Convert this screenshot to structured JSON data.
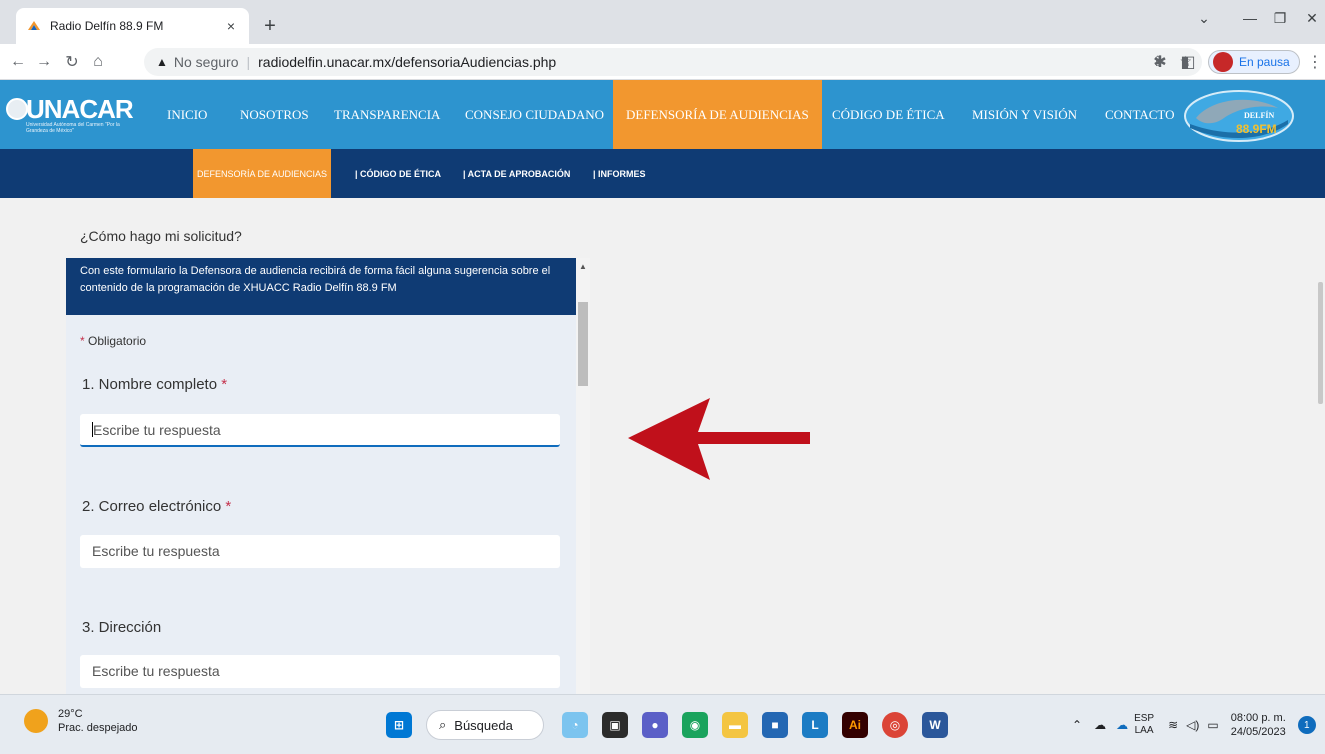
{
  "browser": {
    "tab_title": "Radio Delfín 88.9 FM",
    "tab_close": "×",
    "new_tab": "+",
    "security_label": "No seguro",
    "url": "radiodelfin.unacar.mx/defensoriaAudiencias.php",
    "profile_label": "En pausa"
  },
  "site": {
    "logo_text": "UNACAR",
    "logo_subtitle": "Universidad Autónoma del Carmen \"Por la Grandeza de México\"",
    "nav": [
      {
        "label": "INICIO"
      },
      {
        "label": "NOSOTROS"
      },
      {
        "label": "TRANSPARENCIA"
      },
      {
        "label": "CONSEJO CIUDADANO"
      },
      {
        "label": "DEFENSORÍA DE AUDIENCIAS"
      },
      {
        "label": "CÓDIGO DE ÉTICA"
      },
      {
        "label": "MISIÓN Y VISIÓN"
      },
      {
        "label": "CONTACTO"
      }
    ],
    "radio_logo_top": "DELFÍN",
    "radio_logo_freq": "88.9FM",
    "subnav": [
      {
        "label": "DEFENSORÍA DE AUDIENCIAS"
      },
      {
        "label": "| CÓDIGO DE ÉTICA"
      },
      {
        "label": "| ACTA DE APROBACIÓN"
      },
      {
        "label": "| INFORMES"
      }
    ]
  },
  "content": {
    "question": "¿Cómo hago mi solicitud?"
  },
  "form": {
    "banner_text": "Con este formulario la Defensora de audiencia recibirá de forma fácil alguna sugerencia sobre el contenido de la programación de XHUACC Radio Delfín 88.9 FM",
    "required_note": "Obligatorio",
    "required_mark": "*",
    "questions": [
      {
        "label": "1. Nombre completo",
        "placeholder": "Escribe tu respuesta"
      },
      {
        "label": "2. Correo electrónico",
        "placeholder": "Escribe tu respuesta"
      },
      {
        "label": "3. Dirección",
        "placeholder": "Escribe tu respuesta"
      }
    ]
  },
  "taskbar": {
    "temperature": "29°C",
    "weather": "Prac. despejado",
    "search": "Búsqueda",
    "lang_top": "ESP",
    "lang_bottom": "LAA",
    "time": "08:00 p. m.",
    "date": "24/05/2023",
    "notifications": "1"
  },
  "colors": {
    "nav_bg": "#2d94cf",
    "nav_active": "#f2972f",
    "subnav_bg": "#0f3b74",
    "arrow": "#c0101b"
  }
}
